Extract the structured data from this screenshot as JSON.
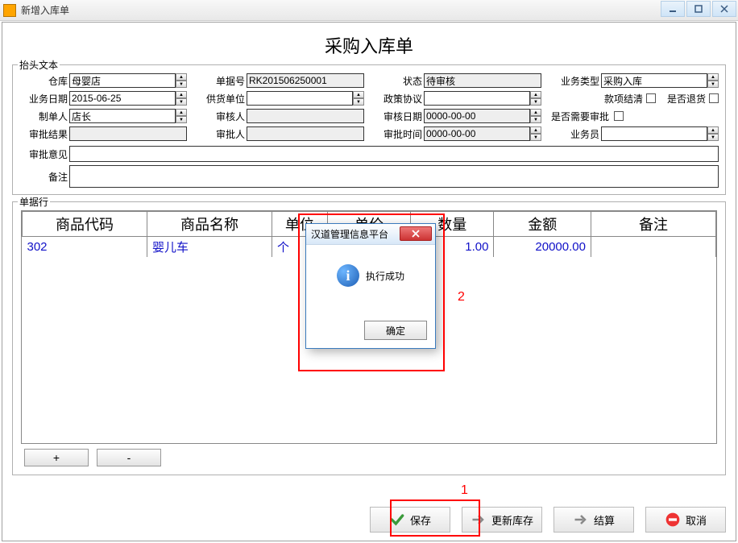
{
  "window": {
    "title": "新增入库单"
  },
  "page": {
    "title": "采购入库单",
    "header_legend": "抬头文本",
    "rows_legend": "单据行"
  },
  "fields": {
    "warehouse": {
      "label": "仓库",
      "value": "母婴店"
    },
    "doc_no": {
      "label": "单据号",
      "value": "RK201506250001"
    },
    "status": {
      "label": "状态",
      "value": "待审核"
    },
    "biz_type": {
      "label": "业务类型",
      "value": "采购入库"
    },
    "biz_date": {
      "label": "业务日期",
      "value": "2015-06-25"
    },
    "supplier": {
      "label": "供货单位",
      "value": ""
    },
    "policy": {
      "label": "政策协议",
      "value": ""
    },
    "pay_clear": {
      "label": "款项结清"
    },
    "is_return": {
      "label": "是否退货"
    },
    "maker": {
      "label": "制单人",
      "value": "店长"
    },
    "auditor": {
      "label": "审核人",
      "value": ""
    },
    "audit_date": {
      "label": "审核日期",
      "value": "0000-00-00"
    },
    "need_audit": {
      "label": "是否需要审批"
    },
    "audit_result": {
      "label": "审批结果",
      "value": ""
    },
    "approver": {
      "label": "审批人",
      "value": ""
    },
    "approve_time": {
      "label": "审批时间",
      "value": "0000-00-00"
    },
    "salesman": {
      "label": "业务员",
      "value": ""
    },
    "audit_opinion": {
      "label": "审批意见",
      "value": ""
    },
    "remark": {
      "label": "备注",
      "value": ""
    }
  },
  "table": {
    "headers": [
      "商品代码",
      "商品名称",
      "单位",
      "单价",
      "数量",
      "金额",
      "备注"
    ],
    "rows": [
      {
        "code": "302",
        "name": "婴儿车",
        "unit": "个",
        "price": "",
        "qty": "1.00",
        "amount": "20000.00",
        "remark": ""
      }
    ]
  },
  "row_buttons": {
    "add": "+",
    "remove": "-"
  },
  "buttons": {
    "save": "保存",
    "update_stock": "更新库存",
    "settle": "结算",
    "cancel": "取消"
  },
  "dialog": {
    "title": "汉道管理信息平台",
    "message": "执行成功",
    "ok": "确定"
  },
  "annotations": {
    "a1": "1",
    "a2": "2"
  }
}
